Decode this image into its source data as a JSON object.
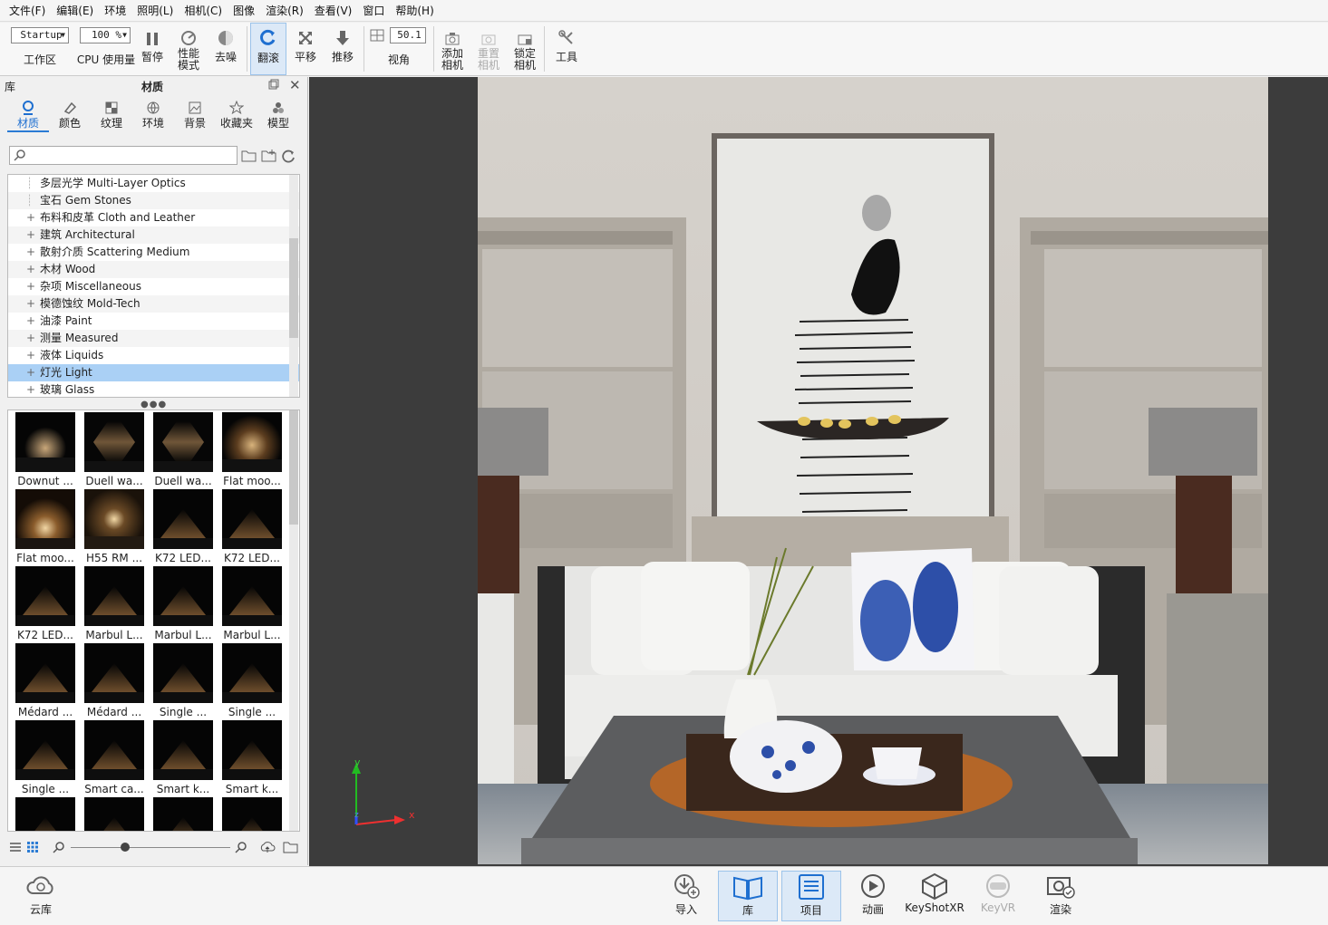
{
  "menu": [
    "文件(F)",
    "编辑(E)",
    "环境",
    "照明(L)",
    "相机(C)",
    "图像",
    "渲染(R)",
    "查看(V)",
    "窗口",
    "帮助(H)"
  ],
  "toolbar": {
    "workspace_value": "Startup",
    "workspace_label": "工作区",
    "cpu_value": "100 %",
    "cpu_label": "CPU 使用量",
    "pause": "暂停",
    "perf_line1": "性能",
    "perf_line2": "模式",
    "denoise": "去噪",
    "tumble": "翻滚",
    "pan": "平移",
    "dolly": "推移",
    "fov_value": "50.1",
    "fov_label": "视角",
    "add_camera_1": "添加",
    "add_camera_2": "相机",
    "reset_camera_1": "重置",
    "reset_camera_2": "相机",
    "lock_camera_1": "锁定",
    "lock_camera_2": "相机",
    "tools": "工具"
  },
  "library": {
    "title_left": "库",
    "title": "材质",
    "tabs": [
      "材质",
      "颜色",
      "纹理",
      "环境",
      "背景",
      "收藏夹",
      "模型"
    ],
    "tree": [
      {
        "label": "多层光学 Multi-Layer Optics",
        "expand": false
      },
      {
        "label": "宝石 Gem Stones",
        "expand": false
      },
      {
        "label": "布料和皮革 Cloth and Leather",
        "expand": true
      },
      {
        "label": "建筑 Architectural",
        "expand": true
      },
      {
        "label": "散射介质 Scattering Medium",
        "expand": true
      },
      {
        "label": "木材 Wood",
        "expand": true
      },
      {
        "label": "杂项 Miscellaneous",
        "expand": true
      },
      {
        "label": "模德蚀纹 Mold-Tech",
        "expand": true
      },
      {
        "label": "油漆 Paint",
        "expand": true
      },
      {
        "label": "测量 Measured",
        "expand": true
      },
      {
        "label": "液体 Liquids",
        "expand": true
      },
      {
        "label": "灯光 Light",
        "expand": true,
        "selected": true
      },
      {
        "label": "玻璃 Glass",
        "expand": true
      }
    ],
    "thumbs": [
      {
        "label": "Downut ...",
        "style": "spot"
      },
      {
        "label": "Duell wa...",
        "style": "duell"
      },
      {
        "label": "Duell wa...",
        "style": "duell2"
      },
      {
        "label": "Flat moo...",
        "style": "flat"
      },
      {
        "label": "Flat moo...",
        "style": "flatbig"
      },
      {
        "label": "H55 RM ...",
        "style": "h55"
      },
      {
        "label": "K72 LED...",
        "style": "cone"
      },
      {
        "label": "K72 LED...",
        "style": "cone"
      },
      {
        "label": "K72 LED...",
        "style": "cone"
      },
      {
        "label": "Marbul L...",
        "style": "cone"
      },
      {
        "label": "Marbul L...",
        "style": "cone"
      },
      {
        "label": "Marbul L...",
        "style": "cone"
      },
      {
        "label": "Médard ...",
        "style": "cone"
      },
      {
        "label": "Médard ...",
        "style": "cone"
      },
      {
        "label": "Single ...",
        "style": "cone"
      },
      {
        "label": "Single ...",
        "style": "cone"
      },
      {
        "label": "Single ...",
        "style": "cone"
      },
      {
        "label": "Smart ca...",
        "style": "cone"
      },
      {
        "label": "Smart k...",
        "style": "cone"
      },
      {
        "label": "Smart k...",
        "style": "cone"
      },
      {
        "label": "",
        "style": "cone"
      },
      {
        "label": "",
        "style": "cone"
      },
      {
        "label": "",
        "style": "cone"
      },
      {
        "label": "",
        "style": "cone"
      }
    ]
  },
  "bottom": {
    "cloud": "云库",
    "import": "导入",
    "library": "库",
    "project": "项目",
    "animation": "动画",
    "keyshotxr": "KeyShotXR",
    "keyvr": "KeyVR",
    "render": "渲染"
  },
  "axis": {
    "y": "y",
    "x": "x",
    "z": "z"
  },
  "colors": {
    "accent": "#2a7bd4",
    "selection": "#aad0f5",
    "viewport_bg": "#3c3c3c"
  }
}
